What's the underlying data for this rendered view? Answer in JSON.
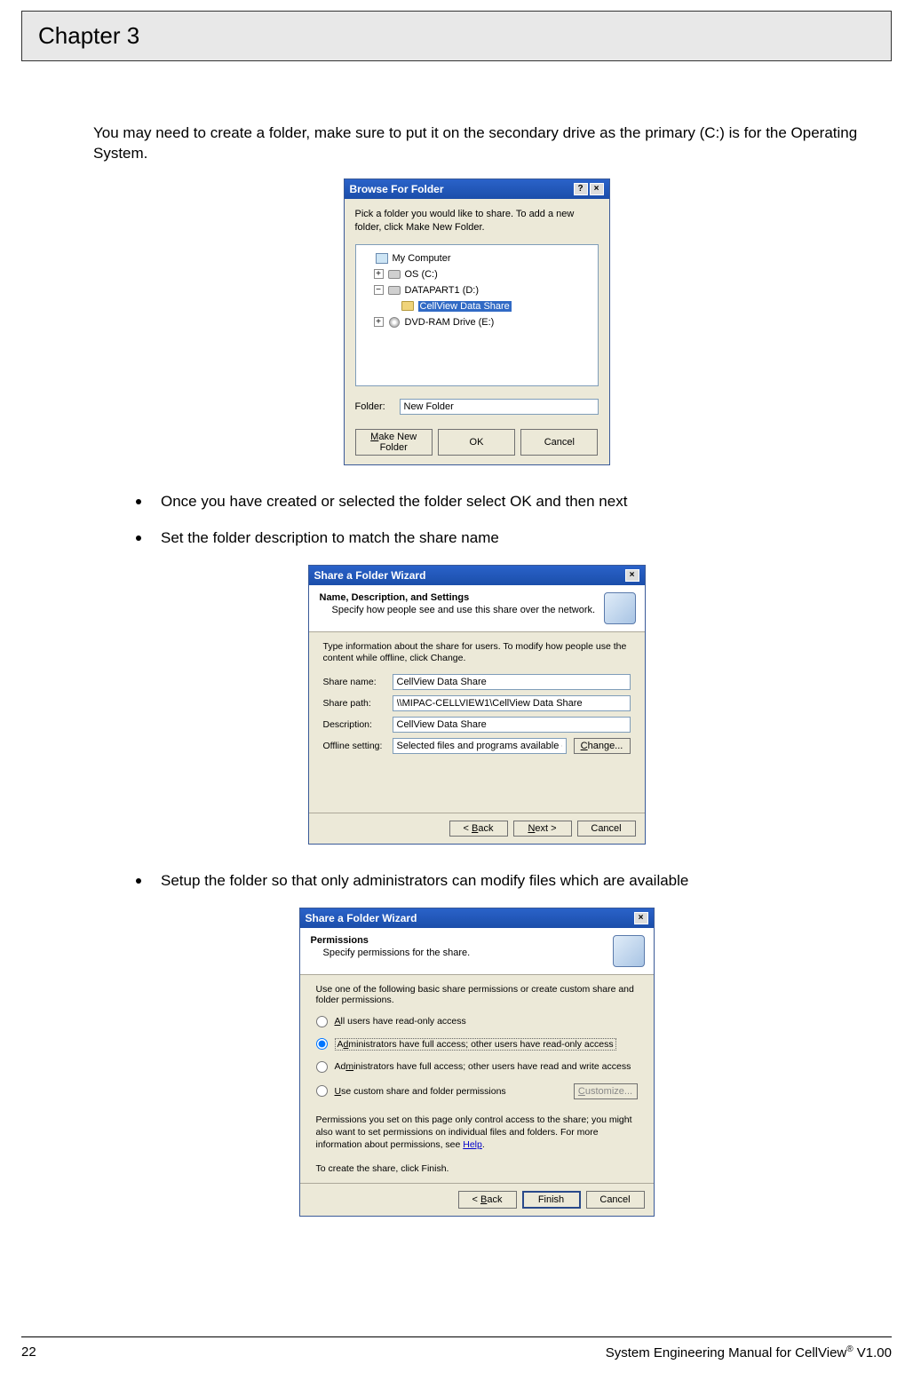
{
  "chapterTitle": "Chapter 3",
  "introText": "You may need to create a folder, make sure to put it on the secondary drive as the primary (C:) is for the Operating System.",
  "bullets": {
    "b1": "Once you have created or selected the folder select OK and then next",
    "b2": "Set the folder description to match the share name",
    "b3": "Setup the folder so that only administrators can modify files which are available"
  },
  "dialog1": {
    "title": "Browse For Folder",
    "helpText": "Pick a folder you would like to share. To add a new folder, click Make New Folder.",
    "tree": {
      "root": "My Computer",
      "drive1": "OS (C:)",
      "drive2": "DATAPART1 (D:)",
      "folderSel": "CellView Data Share",
      "drive3": "DVD-RAM Drive (E:)"
    },
    "folderLabel": "Folder:",
    "folderValue": "New Folder",
    "btnMakeNew": "Make New Folder",
    "btnOK": "OK",
    "btnCancel": "Cancel"
  },
  "dialog2": {
    "title": "Share a Folder Wizard",
    "headerTitle": "Name, Description, and Settings",
    "headerSub": "Specify how people see and use this share over the network.",
    "intro": "Type information about the share for users. To modify how people use the content while offline, click Change.",
    "labels": {
      "shareName": "Share name:",
      "sharePath": "Share path:",
      "description": "Description:",
      "offline": "Offline setting:"
    },
    "values": {
      "shareName": "CellView Data Share",
      "sharePath": "\\\\MIPAC-CELLVIEW1\\CellView Data Share",
      "description": "CellView Data Share",
      "offline": "Selected files and programs available offline"
    },
    "btnChange": "Change...",
    "btnBack": "< Back",
    "btnNext": "Next >",
    "btnCancel": "Cancel"
  },
  "dialog3": {
    "title": "Share a Folder Wizard",
    "headerTitle": "Permissions",
    "headerSub": "Specify permissions for the share.",
    "intro": "Use one of the following basic share permissions or create custom share and folder permissions.",
    "opt1": "All users have read-only access",
    "opt2": "Administrators have full access; other users have read-only access",
    "opt3": "Administrators have full access; other users have read and write access",
    "opt4": "Use custom share and folder permissions",
    "btnCustomize": "Customize...",
    "note": "Permissions you set on this page only control access to the share; you might also want to set permissions on individual files and folders. For more information about permissions, see ",
    "helpLink": "Help",
    "createText": "To create the share, click Finish.",
    "btnBack": "< Back",
    "btnFinish": "Finish",
    "btnCancel": "Cancel"
  },
  "footer": {
    "pageNum": "22",
    "right1": "System Engineering Manual for CellView",
    "right2": " V1.00"
  }
}
